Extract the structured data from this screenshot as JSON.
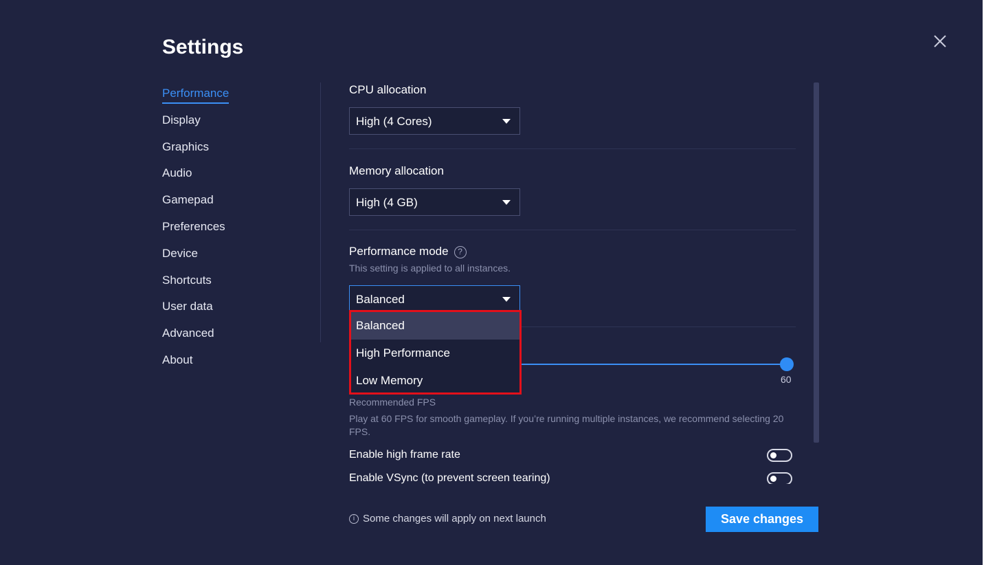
{
  "window": {
    "title": "Settings"
  },
  "icons": {
    "close": "close-icon",
    "help": "help-circle-icon",
    "info": "info-icon",
    "caret": "chevron-down-icon"
  },
  "colors": {
    "accent": "#3b8ff5",
    "background": "#1f2340",
    "highlight_border": "#e3101a",
    "save_button": "#1e8cf5"
  },
  "sidebar": {
    "items": [
      {
        "label": "Performance",
        "active": true
      },
      {
        "label": "Display"
      },
      {
        "label": "Graphics"
      },
      {
        "label": "Audio"
      },
      {
        "label": "Gamepad"
      },
      {
        "label": "Preferences"
      },
      {
        "label": "Device"
      },
      {
        "label": "Shortcuts"
      },
      {
        "label": "User data"
      },
      {
        "label": "Advanced"
      },
      {
        "label": "About"
      }
    ]
  },
  "cpu": {
    "label": "CPU allocation",
    "value": "High (4 Cores)"
  },
  "memory": {
    "label": "Memory allocation",
    "value": "High (4 GB)"
  },
  "perf_mode": {
    "label": "Performance mode",
    "help_glyph": "?",
    "note": "This setting is applied to all instances.",
    "value": "Balanced",
    "options": [
      "Balanced",
      "High Performance",
      "Low Memory"
    ],
    "hovered_option": "Balanced"
  },
  "fps": {
    "value": "60",
    "recommended_label": "Recommended FPS",
    "description": "Play at 60 FPS for smooth gameplay. If you’re running multiple instances, we recommend selecting 20 FPS."
  },
  "toggles": {
    "high_frame_rate": {
      "label": "Enable high frame rate",
      "on": false
    },
    "vsync": {
      "label": "Enable VSync (to prevent screen tearing)",
      "on": false
    }
  },
  "footer": {
    "info_glyph": "i",
    "note": "Some changes will apply on next launch",
    "save_label": "Save changes"
  }
}
